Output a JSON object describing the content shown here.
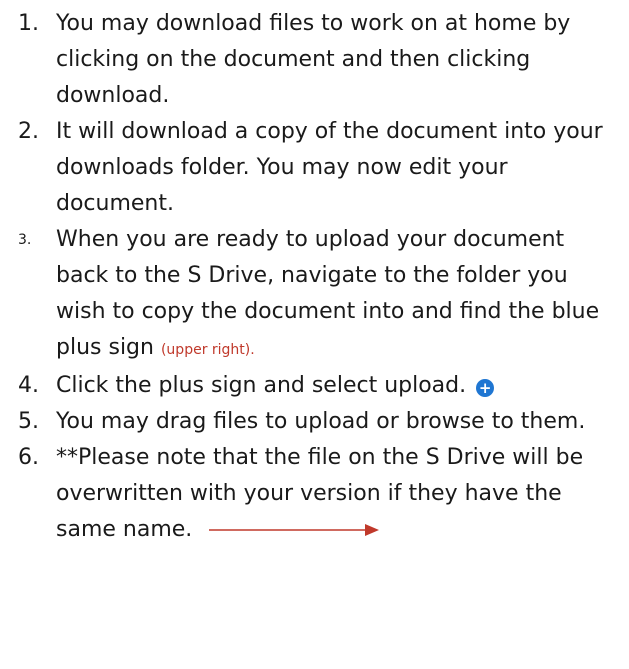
{
  "steps": [
    {
      "number": "1.",
      "text": "You may download files to work on at home by clicking on the document and then clicking download."
    },
    {
      "number": "2.",
      "text": "It will download a copy of the document into your downloads folder. You may now edit your document."
    },
    {
      "number": "3.",
      "text": "When you are ready to upload your document back to the S Drive, navigate to the folder you wish to copy the document into and find the blue plus sign",
      "note": "(upper right)."
    },
    {
      "number": "4.",
      "text": "Click the plus sign and select upload.",
      "icon": "plus-circle-icon"
    },
    {
      "number": "5.",
      "text": "You may drag files to upload or browse to them."
    },
    {
      "number": "6.",
      "text": "**Please note that the file on the S Drive will be overwritten with your version if they have the same name.",
      "icon": "right-arrow-icon"
    }
  ],
  "colors": {
    "text": "#1a1a1a",
    "note": "#c0392b",
    "plus_icon": "#1f76d2",
    "arrow": "#c0392b"
  }
}
